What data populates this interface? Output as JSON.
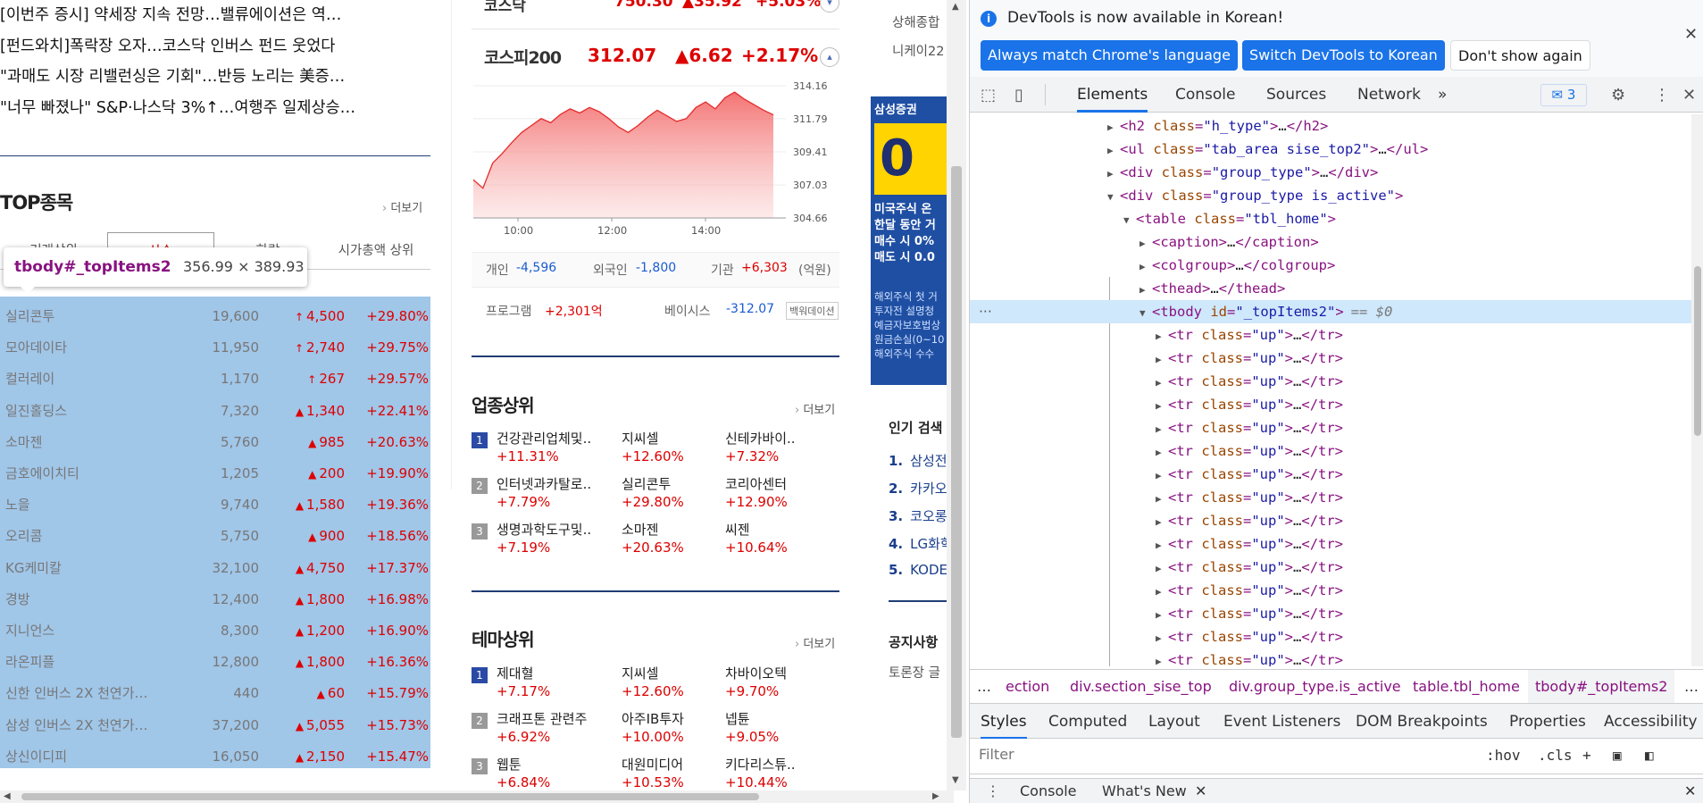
{
  "news": [
    "[이번주 증시] 약세장 지속 전망…밸류에이션은 역…",
    "[펀드와치]폭락장 오자…코스닥 인버스 펀드 웃었다",
    "\"과매도 시장 리밸런싱은 기회\"…반등 노리는 美증…",
    "\"너무 빠졌나\" S&P·나스닥 3%↑…여행주 일제상승…"
  ],
  "top": {
    "title": "TOP종목",
    "more": "더보기",
    "tabs": [
      "거래상위",
      "상승",
      "하락",
      "시가총액 상위"
    ],
    "rows": [
      {
        "name": "실리콘투",
        "price": "19,600",
        "change": "4,500",
        "rate": "+29.80%",
        "arrow": "↑"
      },
      {
        "name": "모아데이타",
        "price": "11,950",
        "change": "2,740",
        "rate": "+29.75%",
        "arrow": "↑"
      },
      {
        "name": "컬러레이",
        "price": "1,170",
        "change": "267",
        "rate": "+29.57%",
        "arrow": "↑"
      },
      {
        "name": "일진홀딩스",
        "price": "7,320",
        "change": "1,340",
        "rate": "+22.41%",
        "arrow": "▲"
      },
      {
        "name": "소마젠",
        "price": "5,760",
        "change": "985",
        "rate": "+20.63%",
        "arrow": "▲"
      },
      {
        "name": "금호에이치티",
        "price": "1,205",
        "change": "200",
        "rate": "+19.90%",
        "arrow": "▲"
      },
      {
        "name": "노을",
        "price": "9,740",
        "change": "1,580",
        "rate": "+19.36%",
        "arrow": "▲"
      },
      {
        "name": "오리콤",
        "price": "5,750",
        "change": "900",
        "rate": "+18.56%",
        "arrow": "▲"
      },
      {
        "name": "KG케미칼",
        "price": "32,100",
        "change": "4,750",
        "rate": "+17.37%",
        "arrow": "▲"
      },
      {
        "name": "경방",
        "price": "12,400",
        "change": "1,800",
        "rate": "+16.98%",
        "arrow": "▲"
      },
      {
        "name": "지니언스",
        "price": "8,300",
        "change": "1,200",
        "rate": "+16.90%",
        "arrow": "▲"
      },
      {
        "name": "라온피플",
        "price": "12,800",
        "change": "1,800",
        "rate": "+16.36%",
        "arrow": "▲"
      },
      {
        "name": "신한 인버스 2X 천연가…",
        "price": "440",
        "change": "60",
        "rate": "+15.79%",
        "arrow": "▲"
      },
      {
        "name": "삼성 인버스 2X 천연가…",
        "price": "37,200",
        "change": "5,055",
        "rate": "+15.73%",
        "arrow": "▲"
      },
      {
        "name": "상신이디피",
        "price": "16,050",
        "change": "2,150",
        "rate": "+15.47%",
        "arrow": "▲"
      }
    ]
  },
  "tooltip": {
    "name": "tbody#_topItems2",
    "size": "356.99 × 389.93"
  },
  "kosdaq": {
    "name": "코스닥",
    "value": "750.30",
    "change": "▲35.92",
    "rate": "+5.03%"
  },
  "kospi200": {
    "name": "코스피200",
    "value": "312.07",
    "change": "▲6.62",
    "rate": "+2.17%"
  },
  "chart_data": {
    "type": "area",
    "x_ticks": [
      "10:00",
      "12:00",
      "14:00"
    ],
    "y_ticks": [
      "314.16",
      "311.79",
      "309.41",
      "307.03",
      "304.66"
    ],
    "ylim": [
      304.66,
      314.16
    ],
    "values": [
      307.4,
      306.8,
      308.6,
      309.3,
      310.1,
      310.8,
      311.3,
      311.8,
      311.5,
      312.1,
      312.5,
      312.2,
      312.6,
      312.3,
      311.8,
      311.2,
      310.8,
      311.3,
      311.9,
      312.4,
      312.0,
      311.6,
      311.8,
      312.6,
      313.0,
      312.5,
      313.3,
      313.7,
      313.2,
      312.8,
      312.4,
      312.07
    ]
  },
  "stats": {
    "individual_label": "개인",
    "individual": "-4,596",
    "foreign_label": "외국인",
    "foreign": "-1,800",
    "inst_label": "기관",
    "inst": "+6,303",
    "unit": "(억원)",
    "program_label": "프로그램",
    "program": "+2,301억",
    "basis_label": "베이시스",
    "basis": "-312.07",
    "basis_tag": "백워데이션"
  },
  "sectors": {
    "title": "업종상위",
    "more": "더보기",
    "rows": [
      {
        "rank": "1",
        "items": [
          {
            "n": "건강관리업체및..",
            "r": "+11.31%"
          },
          {
            "n": "지씨셀",
            "r": "+12.60%"
          },
          {
            "n": "신테카바이..",
            "r": "+7.32%"
          }
        ]
      },
      {
        "rank": "2",
        "items": [
          {
            "n": "인터넷과카탈로..",
            "r": "+7.79%"
          },
          {
            "n": "실리콘투",
            "r": "+29.80%"
          },
          {
            "n": "코리아센터",
            "r": "+12.90%"
          }
        ]
      },
      {
        "rank": "3",
        "items": [
          {
            "n": "생명과학도구및..",
            "r": "+7.19%"
          },
          {
            "n": "소마젠",
            "r": "+20.63%"
          },
          {
            "n": "씨젠",
            "r": "+10.64%"
          }
        ]
      }
    ]
  },
  "themes": {
    "title": "테마상위",
    "more": "더보기",
    "rows": [
      {
        "rank": "1",
        "items": [
          {
            "n": "제대혈",
            "r": "+7.17%"
          },
          {
            "n": "지씨셀",
            "r": "+12.60%"
          },
          {
            "n": "차바이오텍",
            "r": "+9.70%"
          }
        ]
      },
      {
        "rank": "2",
        "items": [
          {
            "n": "크래프톤 관련주",
            "r": "+6.92%"
          },
          {
            "n": "아주IB투자",
            "r": "+10.00%"
          },
          {
            "n": "넵튠",
            "r": "+9.05%"
          }
        ]
      },
      {
        "rank": "3",
        "items": [
          {
            "n": "웹툰",
            "r": "+6.84%"
          },
          {
            "n": "대원미디어",
            "r": "+10.53%"
          },
          {
            "n": "키다리스튜..",
            "r": "+10.44%"
          }
        ]
      }
    ]
  },
  "right_col": {
    "t0": "상해종합",
    "t1": "니케이22",
    "ad_title": "삼성증권",
    "ad_big": "0",
    "ad_lines": [
      "미국주식 온",
      "한달 동안 거",
      "매수 시 0%",
      "매도 시 0.0"
    ],
    "ad_fine": [
      "해외주식 첫 거",
      "투자전 설명청",
      "예금자보호법상",
      "원금손실(0~10",
      "해외주식 수수"
    ],
    "popular_title": "인기 검색",
    "popular": [
      {
        "n": "1.",
        "t": "삼성전"
      },
      {
        "n": "2.",
        "t": "카카오"
      },
      {
        "n": "3.",
        "t": "코오롱"
      },
      {
        "n": "4.",
        "t": "LG화학"
      },
      {
        "n": "5.",
        "t": "KODE"
      }
    ],
    "notice_title": "공지사항",
    "notice": "토론장 글"
  },
  "devtools": {
    "info_text": "DevTools is now available in Korean!",
    "btn_match": "Always match Chrome's language",
    "btn_switch": "Switch DevTools to Korean",
    "btn_dont": "Don't show again",
    "tabs": [
      "Elements",
      "Console",
      "Sources",
      "Network"
    ],
    "more_tabs": "»",
    "msg_count": "3",
    "dollar": "== $0",
    "crumbs": [
      "ection",
      "div.section_sise_top",
      "div.group_type.is_active",
      "table.tbl_home",
      "tbody#_topItems2"
    ],
    "subtabs": [
      "Styles",
      "Computed",
      "Layout",
      "Event Listeners",
      "DOM Breakpoints",
      "Properties",
      "Accessibility"
    ],
    "filter_placeholder": "Filter",
    "hov": ":hov",
    "cls": ".cls",
    "drawer": [
      "Console",
      "What's New"
    ]
  }
}
